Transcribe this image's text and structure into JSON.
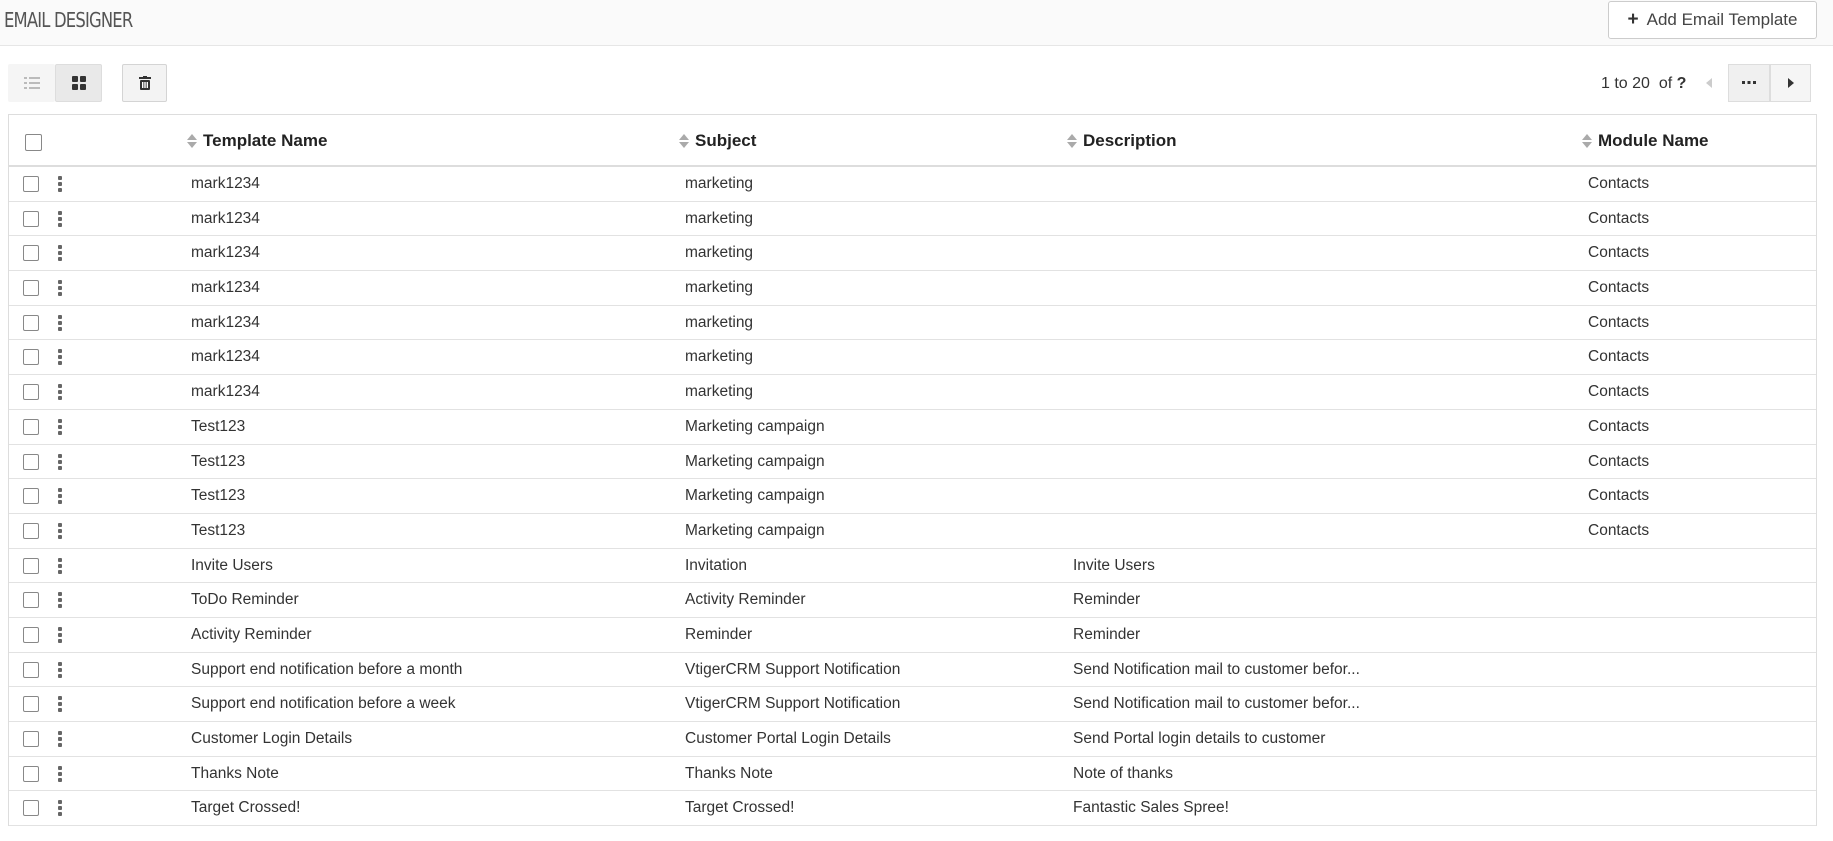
{
  "header": {
    "title": "EMAIL DESIGNER",
    "add_button_label": "Add Email Template"
  },
  "toolbar": {
    "list_view_icon": "list-icon",
    "grid_view_icon": "grid-icon",
    "delete_icon": "trash-icon"
  },
  "pager": {
    "range": "1 to 20",
    "of_label": "of",
    "total": "?"
  },
  "table": {
    "columns": [
      "Template Name",
      "Subject",
      "Description",
      "Module Name"
    ],
    "rows": [
      {
        "name": "mark1234",
        "subject": "marketing",
        "description": "",
        "module": "Contacts"
      },
      {
        "name": "mark1234",
        "subject": "marketing",
        "description": "",
        "module": "Contacts"
      },
      {
        "name": "mark1234",
        "subject": "marketing",
        "description": "",
        "module": "Contacts"
      },
      {
        "name": "mark1234",
        "subject": "marketing",
        "description": "",
        "module": "Contacts"
      },
      {
        "name": "mark1234",
        "subject": "marketing",
        "description": "",
        "module": "Contacts"
      },
      {
        "name": "mark1234",
        "subject": "marketing",
        "description": "",
        "module": "Contacts"
      },
      {
        "name": "mark1234",
        "subject": "marketing",
        "description": "",
        "module": "Contacts"
      },
      {
        "name": "Test123",
        "subject": "Marketing campaign",
        "description": "",
        "module": "Contacts"
      },
      {
        "name": "Test123",
        "subject": "Marketing campaign",
        "description": "",
        "module": "Contacts"
      },
      {
        "name": "Test123",
        "subject": "Marketing campaign",
        "description": "",
        "module": "Contacts"
      },
      {
        "name": "Test123",
        "subject": "Marketing campaign",
        "description": "",
        "module": "Contacts"
      },
      {
        "name": "Invite Users",
        "subject": "Invitation",
        "description": "Invite Users",
        "module": ""
      },
      {
        "name": "ToDo Reminder",
        "subject": "Activity Reminder",
        "description": "Reminder",
        "module": ""
      },
      {
        "name": "Activity Reminder",
        "subject": "Reminder",
        "description": "Reminder",
        "module": ""
      },
      {
        "name": "Support end notification before a month",
        "subject": "VtigerCRM Support Notification",
        "description": "Send Notification mail to customer befor...",
        "module": ""
      },
      {
        "name": "Support end notification before a week",
        "subject": "VtigerCRM Support Notification",
        "description": "Send Notification mail to customer befor...",
        "module": ""
      },
      {
        "name": "Customer Login Details",
        "subject": "Customer Portal Login Details",
        "description": "Send Portal login details to customer",
        "module": ""
      },
      {
        "name": "Thanks Note",
        "subject": "Thanks Note",
        "description": "Note of thanks",
        "module": ""
      },
      {
        "name": "Target Crossed!",
        "subject": "Target Crossed!",
        "description": "Fantastic Sales Spree!",
        "module": ""
      }
    ]
  }
}
